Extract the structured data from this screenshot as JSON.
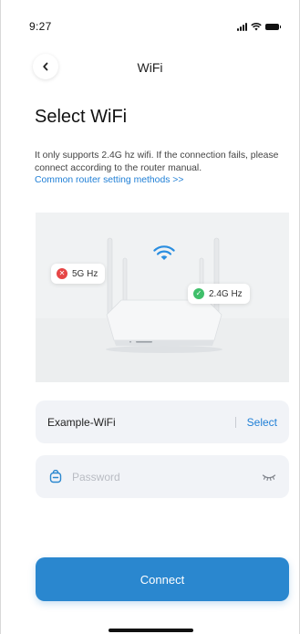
{
  "status_bar": {
    "time": "9:27",
    "icons": [
      "cellular-signal-icon",
      "wifi-icon",
      "battery-icon"
    ]
  },
  "nav": {
    "back_icon": "chevron-left-icon",
    "title": "WiFi"
  },
  "page": {
    "title": "Select WiFi",
    "description": "It only supports 2.4G hz wifi. If the connection fails, please connect according to the router manual.",
    "link": "Common router setting methods >>"
  },
  "illustration": {
    "badge_5g": {
      "label": "5G Hz",
      "icon": "error-x-icon",
      "color": "#e64545"
    },
    "badge_24g": {
      "label": "2.4G Hz",
      "icon": "check-icon",
      "color": "#3fbf6a"
    },
    "signal_icon": "wifi-icon",
    "signal_color": "#2a8ee0"
  },
  "form": {
    "ssid_value": "Example-WiFi",
    "select_label": "Select",
    "password_placeholder": "Password",
    "password_value": "",
    "lock_icon": "lock-icon",
    "eye_icon": "eye-closed-icon"
  },
  "actions": {
    "connect_label": "Connect"
  },
  "colors": {
    "accent": "#2a87cf",
    "link": "#1f7fd6",
    "field_bg": "#f1f3f7"
  }
}
